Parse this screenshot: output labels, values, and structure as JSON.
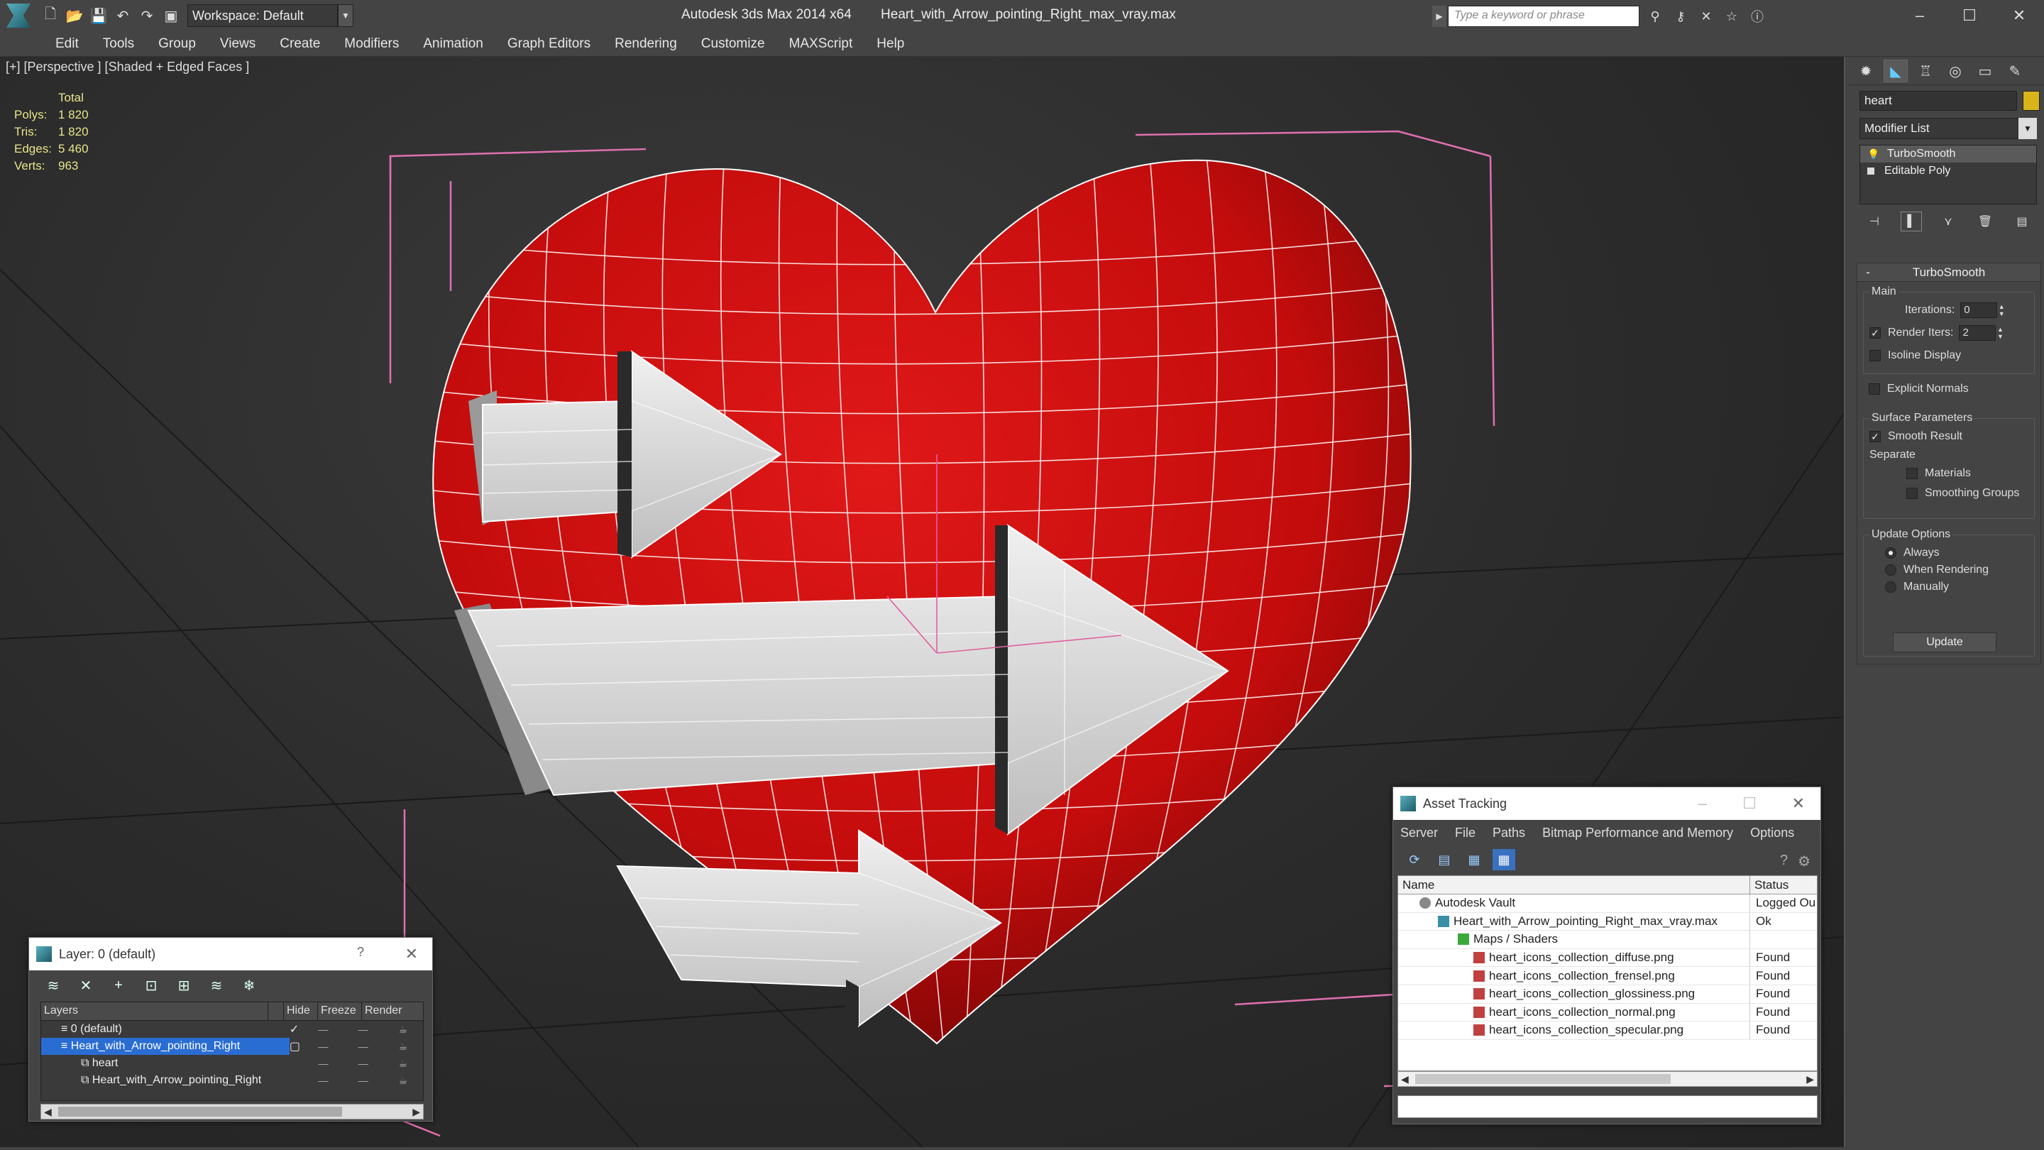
{
  "titlebar": {
    "workspace": "Workspace: Default",
    "app_title": "Autodesk 3ds Max 2014 x64",
    "file_name": "Heart_with_Arrow_pointing_Right_max_vray.max",
    "search_placeholder": "Type a keyword or phrase"
  },
  "menu": [
    "Edit",
    "Tools",
    "Group",
    "Views",
    "Create",
    "Modifiers",
    "Animation",
    "Graph Editors",
    "Rendering",
    "Customize",
    "MAXScript",
    "Help"
  ],
  "viewport": {
    "label": "[+] [Perspective ] [Shaded + Edged Faces ]",
    "stats": {
      "header": "Total",
      "rows": [
        {
          "k": "Polys:",
          "v": "1 820"
        },
        {
          "k": "Tris:",
          "v": "1 820"
        },
        {
          "k": "Edges:",
          "v": "5 460"
        },
        {
          "k": "Verts:",
          "v": "963"
        }
      ]
    }
  },
  "command_panel": {
    "object_name": "heart",
    "object_color": "#d8b41a",
    "modifier_list": "Modifier List",
    "stack": [
      {
        "label": "TurboSmooth",
        "selected": true
      },
      {
        "label": "Editable Poly",
        "selected": false
      }
    ],
    "rollout_title": "TurboSmooth",
    "main_group": "Main",
    "iterations_label": "Iterations:",
    "iterations_value": "0",
    "render_iters_label": "Render Iters:",
    "render_iters_value": "2",
    "isoline_label": "Isoline Display",
    "explicit_normals_label": "Explicit Normals",
    "surface_group": "Surface Parameters",
    "smooth_result_label": "Smooth Result",
    "separate_label": "Separate",
    "materials_label": "Materials",
    "smoothing_groups_label": "Smoothing Groups",
    "update_group": "Update Options",
    "always_label": "Always",
    "when_rendering_label": "When Rendering",
    "manually_label": "Manually",
    "update_button": "Update"
  },
  "layer_dialog": {
    "title": "Layer: 0 (default)",
    "question": "?",
    "columns": [
      "Layers",
      "Hide",
      "Freeze",
      "Render"
    ],
    "rows": [
      {
        "name": "0 (default)",
        "indent": 1,
        "selected": false
      },
      {
        "name": "Heart_with_Arrow_pointing_Right",
        "indent": 1,
        "selected": true
      },
      {
        "name": "heart",
        "indent": 2,
        "selected": false
      },
      {
        "name": "Heart_with_Arrow_pointing_Right",
        "indent": 2,
        "selected": false
      }
    ]
  },
  "asset_dialog": {
    "title": "Asset Tracking",
    "menu": [
      "Server",
      "File",
      "Paths",
      "Bitmap Performance and Memory",
      "Options"
    ],
    "columns": [
      "Name",
      "Status"
    ],
    "rows": [
      {
        "name": "Autodesk Vault",
        "status": "Logged Ou",
        "indent": 1,
        "icon": "vault"
      },
      {
        "name": "Heart_with_Arrow_pointing_Right_max_vray.max",
        "status": "Ok",
        "indent": 2,
        "icon": "max"
      },
      {
        "name": "Maps / Shaders",
        "status": "",
        "indent": 3,
        "icon": "maps"
      },
      {
        "name": "heart_icons_collection_diffuse.png",
        "status": "Found",
        "indent": 4,
        "icon": "png"
      },
      {
        "name": "heart_icons_collection_frensel.png",
        "status": "Found",
        "indent": 4,
        "icon": "png"
      },
      {
        "name": "heart_icons_collection_glossiness.png",
        "status": "Found",
        "indent": 4,
        "icon": "png"
      },
      {
        "name": "heart_icons_collection_normal.png",
        "status": "Found",
        "indent": 4,
        "icon": "png"
      },
      {
        "name": "heart_icons_collection_specular.png",
        "status": "Found",
        "indent": 4,
        "icon": "png"
      }
    ]
  },
  "colors": {
    "heart_red": "#c81010",
    "arrow_grey": "#d8d8d8",
    "selection_blue": "#2a6dd2",
    "bbox_pink": "#e070b0"
  }
}
